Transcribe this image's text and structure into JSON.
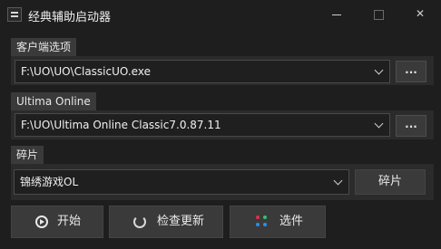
{
  "window": {
    "title": "经典辅助启动器",
    "controls": [
      "minimize-icon",
      "maximize-icon",
      "close-icon"
    ],
    "close_glyph": "✕"
  },
  "client_section": {
    "label": "客户端选项",
    "path": "F:\\UO\\UO\\ClassicUO.exe",
    "browse_label": "..."
  },
  "uo_section": {
    "label": "Ultima Online",
    "path": "F:\\UO\\Ultima Online Classic7.0.87.11",
    "browse_label": "..."
  },
  "shard_section": {
    "label": "碎片",
    "selected": "锦绣游戏OL",
    "button_label": "碎片"
  },
  "actions": {
    "start_label": "开始",
    "update_label": "检查更新",
    "options_label": "选件"
  },
  "colors": {
    "background": "#1e1e1e",
    "panel": "#2b2b2b",
    "button": "#3a3a3a",
    "dot_red": "#e0304a",
    "dot_green": "#2fc26e",
    "dot_blue": "#2e8de8"
  }
}
